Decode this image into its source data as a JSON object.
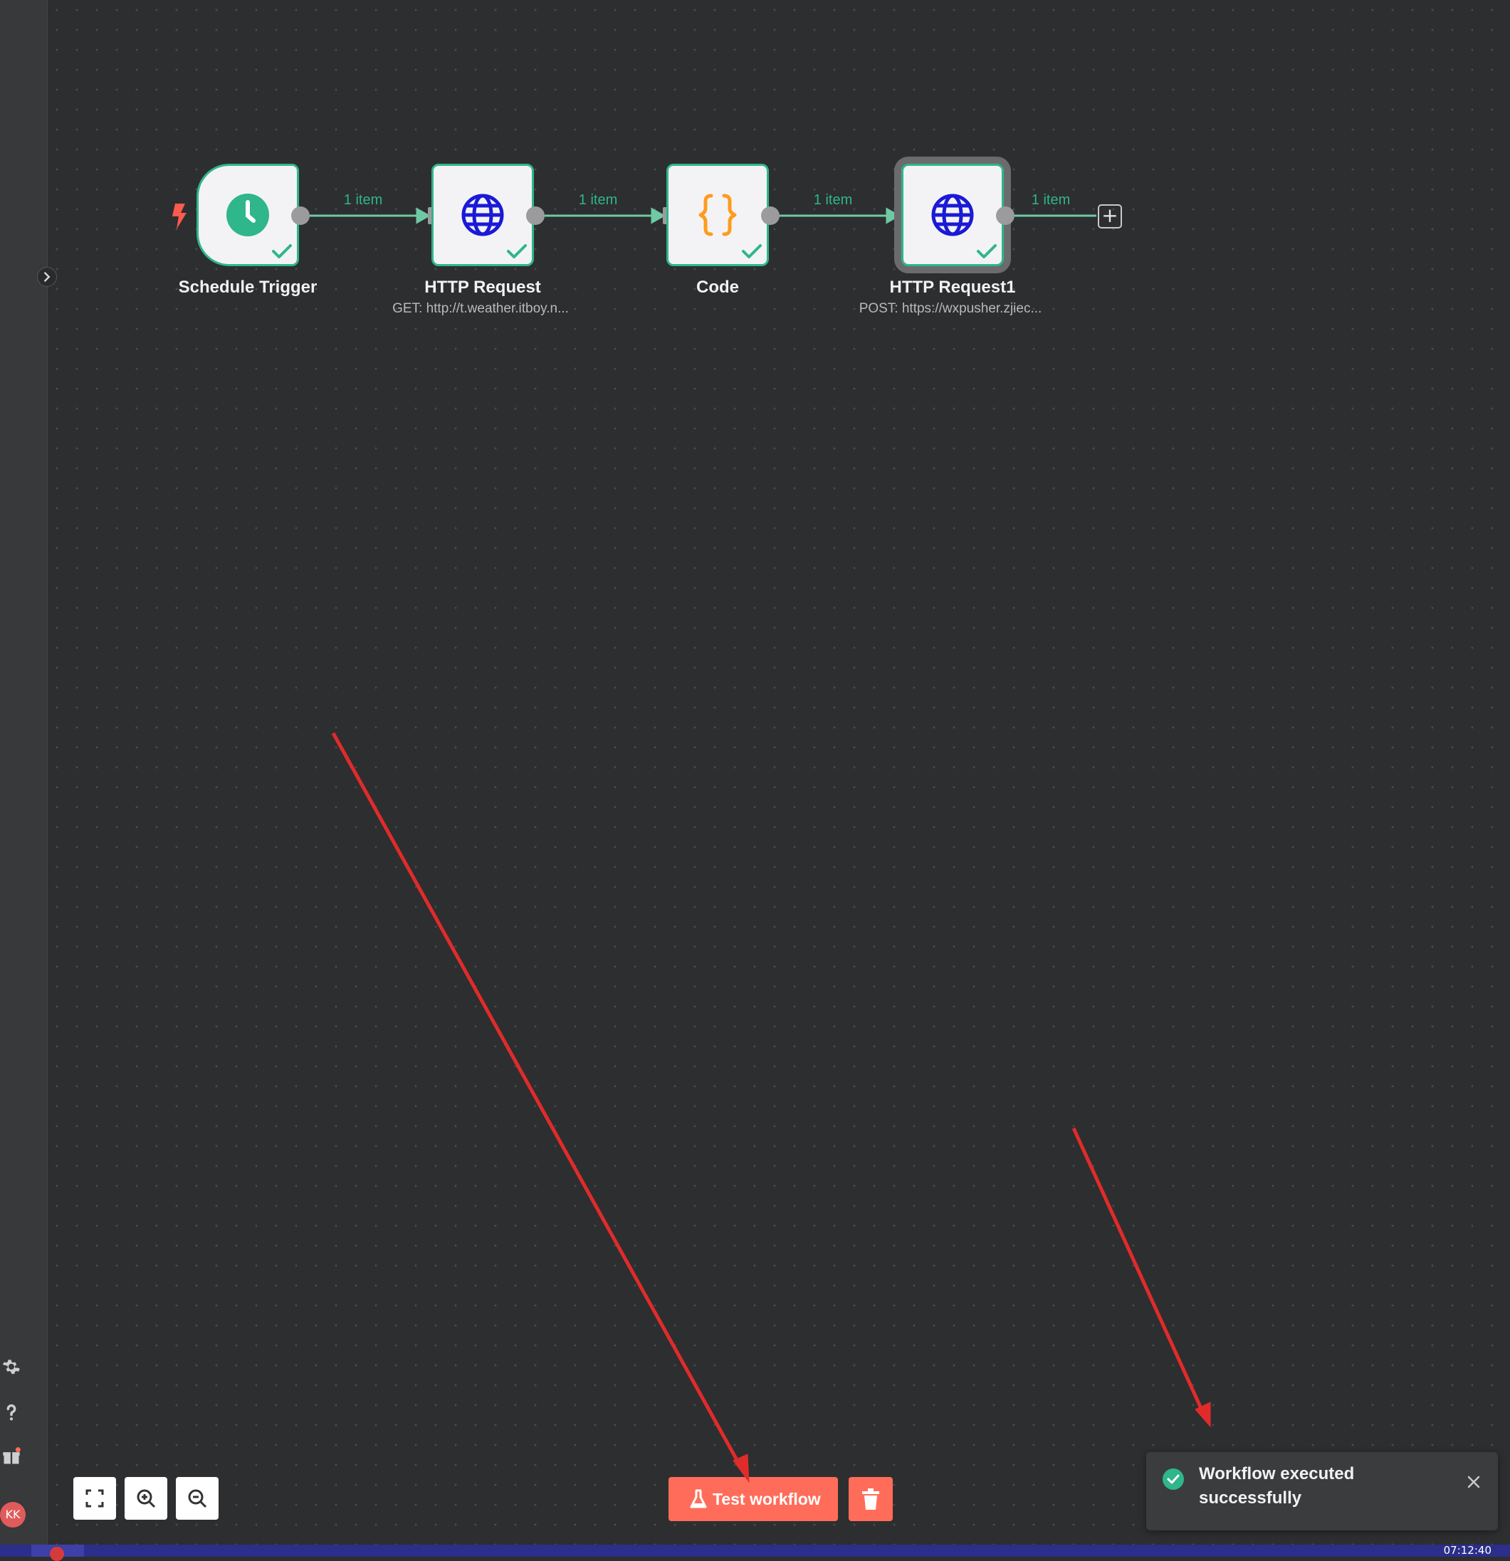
{
  "nodes": [
    {
      "label": "Schedule Trigger",
      "subtitle": "",
      "icon": "clock-icon"
    },
    {
      "label": "HTTP Request",
      "subtitle": "GET: http://t.weather.itboy.n...",
      "icon": "globe-icon"
    },
    {
      "label": "Code",
      "subtitle": "",
      "icon": "code-braces-icon"
    },
    {
      "label": "HTTP Request1",
      "subtitle": "POST: https://wxpusher.zjiec...",
      "icon": "globe-icon"
    }
  ],
  "connections": [
    {
      "label": "1 item"
    },
    {
      "label": "1 item"
    },
    {
      "label": "1 item"
    },
    {
      "label": "1 item"
    }
  ],
  "toolbar": {
    "test_label": "Test workflow",
    "delete_icon": "trash-icon"
  },
  "zoom_controls": [
    "fit-view-icon",
    "zoom-in-icon",
    "zoom-out-icon"
  ],
  "sidebar": {
    "items": [
      "settings-icon",
      "help-icon",
      "gift-icon"
    ],
    "user_initials": "KK"
  },
  "toast": {
    "message": "Workflow executed successfully",
    "status": "success"
  },
  "taskbar": {
    "time": "07:12:40"
  },
  "colors": {
    "success": "#2fb68a",
    "accent": "#ff6d5a",
    "canvas": "#2d2e2f",
    "annotation_arrow": "#e02b2b"
  }
}
